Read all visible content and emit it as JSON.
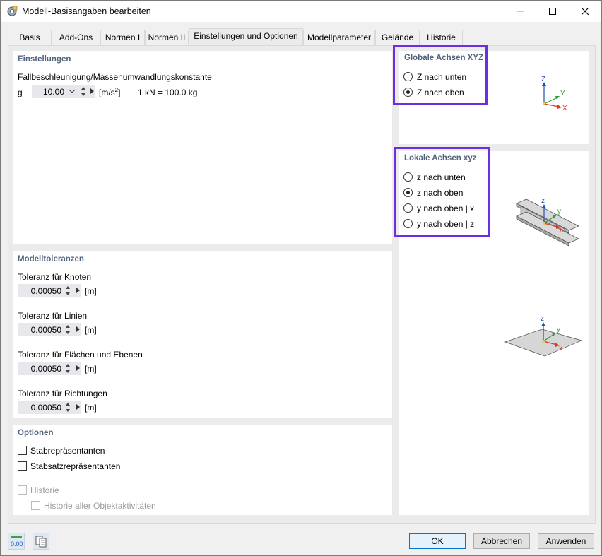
{
  "window": {
    "title": "Modell-Basisangaben bearbeiten"
  },
  "tabs": [
    {
      "label": "Basis"
    },
    {
      "label": "Add-Ons"
    },
    {
      "label": "Normen I"
    },
    {
      "label": "Normen II"
    },
    {
      "label": "Einstellungen und Optionen"
    },
    {
      "label": "Modellparameter"
    },
    {
      "label": "Gelände"
    },
    {
      "label": "Historie"
    }
  ],
  "einstellungen": {
    "title": "Einstellungen",
    "subtitle": "Fallbeschleunigung/Massenumwandlungskonstante",
    "g_label": "g",
    "g_value": "10.00",
    "g_unit_base": "[m/s",
    "g_unit_sup": "2",
    "g_unit_end": "]",
    "conversion": "1 kN = 100.0 kg"
  },
  "toleranzen": {
    "title": "Modelltoleranzen",
    "items": [
      {
        "label": "Toleranz für Knoten",
        "value": "0.00050",
        "unit": "[m]"
      },
      {
        "label": "Toleranz für Linien",
        "value": "0.00050",
        "unit": "[m]"
      },
      {
        "label": "Toleranz für Flächen und Ebenen",
        "value": "0.00050",
        "unit": "[m]"
      },
      {
        "label": "Toleranz für Richtungen",
        "value": "0.00050",
        "unit": "[m]"
      }
    ]
  },
  "optionen": {
    "title": "Optionen",
    "items": [
      {
        "label": "Stabrepräsentanten",
        "checked": false
      },
      {
        "label": "Stabsatzrepräsentanten",
        "checked": false
      },
      {
        "label": "Historie",
        "checked": false,
        "disabled": true
      },
      {
        "label": "Historie aller Objektaktivitäten",
        "checked": false,
        "disabled": true
      }
    ]
  },
  "globale_achsen": {
    "title": "Globale Achsen XYZ",
    "options": [
      {
        "label": "Z nach unten",
        "selected": false
      },
      {
        "label": "Z nach oben",
        "selected": true
      }
    ],
    "axis_labels": {
      "z": "Z",
      "y": "Y",
      "x": "X"
    }
  },
  "lokale_achsen": {
    "title": "Lokale Achsen xyz",
    "options": [
      {
        "label": "z nach unten",
        "selected": false
      },
      {
        "label": "z nach oben",
        "selected": true
      },
      {
        "label": "y nach oben | x",
        "selected": false
      },
      {
        "label": "y nach oben | z",
        "selected": false
      }
    ],
    "axis_labels": {
      "z": "z",
      "y": "y",
      "x": "x"
    }
  },
  "footer": {
    "tool1_label": "0.00",
    "ok": "OK",
    "cancel": "Abbrechen",
    "apply": "Anwenden"
  },
  "colors": {
    "highlight": "#6b2fe0",
    "section_title": "#52637c",
    "axis_z": "#1f4fb5",
    "axis_y": "#2e9b3c",
    "axis_x": "#d9382a"
  }
}
